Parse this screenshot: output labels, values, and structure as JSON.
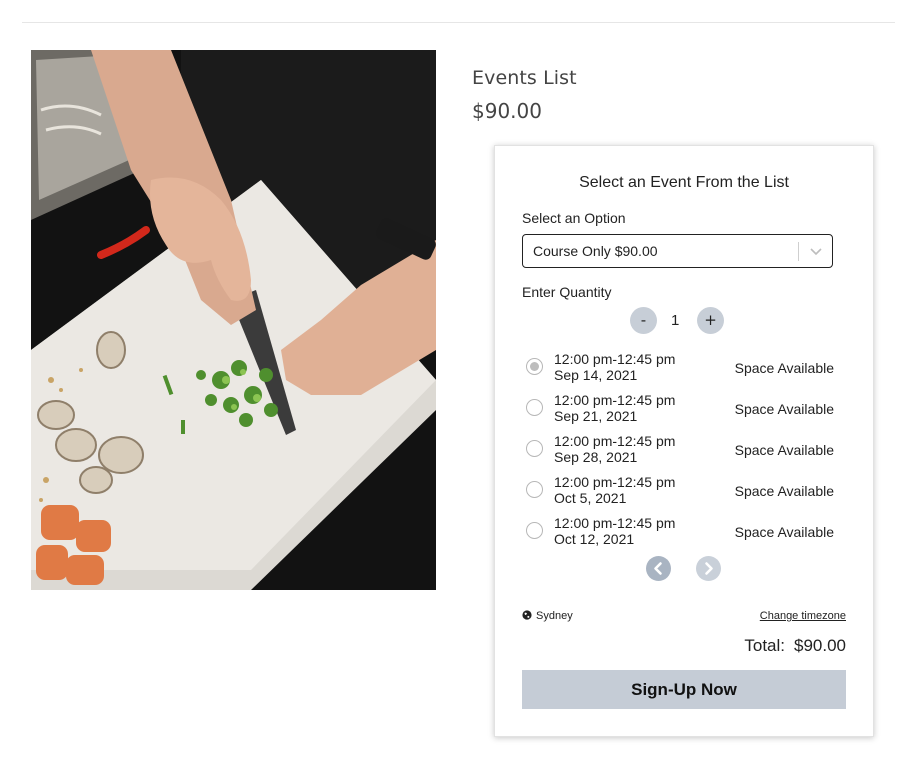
{
  "product": {
    "title": "Events List",
    "price": "$90.00"
  },
  "booking": {
    "heading": "Select an Event From the List",
    "option_label": "Select an Option",
    "selected_option": "Course Only $90.00",
    "quantity_label": "Enter Quantity",
    "quantity": "1",
    "minus_label": "-",
    "plus_label": "+",
    "slots": [
      {
        "time": "12:00 pm-12:45 pm",
        "date": "Sep 14, 2021",
        "status": "Space Available",
        "selected": true
      },
      {
        "time": "12:00 pm-12:45 pm",
        "date": "Sep 21, 2021",
        "status": "Space Available",
        "selected": false
      },
      {
        "time": "12:00 pm-12:45 pm",
        "date": "Sep 28, 2021",
        "status": "Space Available",
        "selected": false
      },
      {
        "time": "12:00 pm-12:45 pm",
        "date": "Oct 5, 2021",
        "status": "Space Available",
        "selected": false
      },
      {
        "time": "12:00 pm-12:45 pm",
        "date": "Oct 12, 2021",
        "status": "Space Available",
        "selected": false
      }
    ],
    "timezone": "Sydney",
    "change_timezone": "Change timezone",
    "total_label": "Total:",
    "total_value": "$90.00",
    "signup_label": "Sign-Up Now"
  },
  "icons": {
    "option_dropdown": "chevron-down-icon",
    "prev_page": "chevron-left-icon",
    "next_page": "chevron-right-icon",
    "timezone": "globe-icon"
  },
  "colors": {
    "button_fill": "#c5ccd6",
    "qty_button_fill": "#c7ced7",
    "nav_prev_fill": "#a9b4c2",
    "nav_next_fill": "#c9d0d9"
  }
}
